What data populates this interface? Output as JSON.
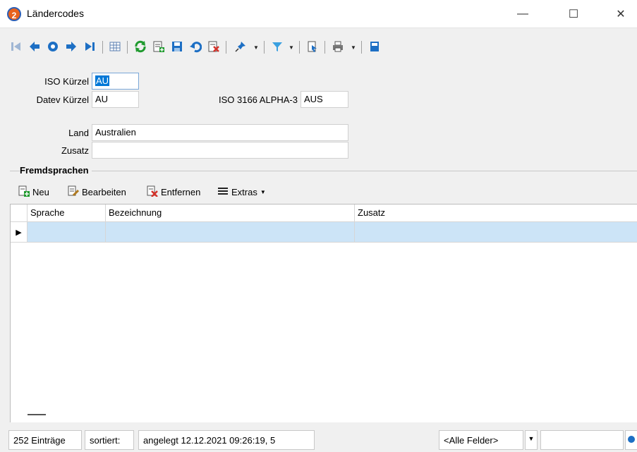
{
  "window": {
    "title": "Ländercodes",
    "icon_text": "2",
    "controls": {
      "minimize": "—",
      "maximize": "☐",
      "close": "✕"
    }
  },
  "toolbar": {
    "icons": [
      "first-record-icon",
      "previous-record-icon",
      "search-record-icon",
      "next-record-icon",
      "last-record-icon",
      "table-view-icon",
      "refresh-icon",
      "new-record-icon",
      "save-icon",
      "undo-icon",
      "delete-icon",
      "pin-icon",
      "filter-icon",
      "export-icon",
      "print-icon",
      "save-layout-icon"
    ]
  },
  "form": {
    "iso_label": "ISO Kürzel",
    "iso_value": "AU",
    "datev_label": "Datev Kürzel",
    "datev_value": "AU",
    "alpha3_label": "ISO 3166 ALPHA-3",
    "alpha3_value": "AUS",
    "land_label": "Land",
    "land_value": "Australien",
    "zusatz_label": "Zusatz",
    "zusatz_value": ""
  },
  "fremdsprachen": {
    "title": "Fremdsprachen",
    "buttons": {
      "new": "Neu",
      "edit": "Bearbeiten",
      "remove": "Entfernen",
      "extras": "Extras"
    },
    "columns": [
      "Sprache",
      "Bezeichnung",
      "Zusatz"
    ],
    "rows": [
      {
        "Sprache": "",
        "Bezeichnung": "",
        "Zusatz": ""
      }
    ]
  },
  "status": {
    "count": "252 Einträge",
    "sorted": "sortiert:",
    "created": "angelegt 12.12.2021 09:26:19,  5",
    "field_filter": "<Alle Felder>",
    "search_value": ""
  },
  "colors": {
    "accent": "#0078d7",
    "selection_row": "#cce4f7",
    "nav_arrow": "#1d6fc4",
    "green": "#1f9a2e",
    "red": "#d4322a"
  }
}
